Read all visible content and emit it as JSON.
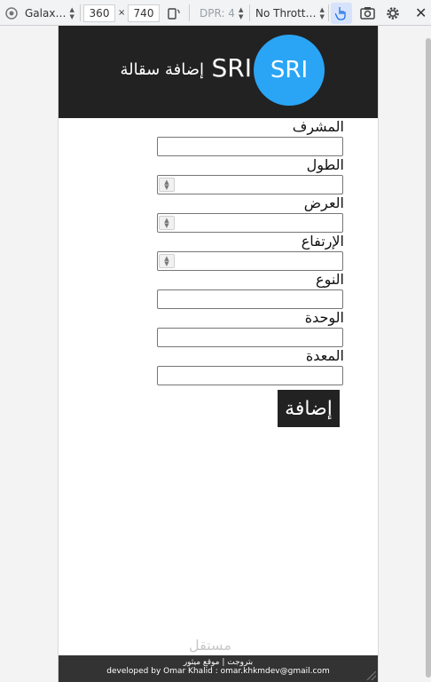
{
  "devtools": {
    "device": "Galax…",
    "width": "360",
    "times": "×",
    "height": "740",
    "dpr": "DPR: 4",
    "throttle": "No Thrott…",
    "close_glyph": "✕"
  },
  "header": {
    "logo_text": "SRI",
    "brand": "SRI",
    "subtitle": "إضافة سقالة",
    "background": "#222222",
    "logo_color": "#2aa5f5"
  },
  "form": {
    "fields": [
      {
        "label": "المشرف",
        "type": "text",
        "value": ""
      },
      {
        "label": "الطول",
        "type": "number",
        "value": ""
      },
      {
        "label": "العرض",
        "type": "number",
        "value": ""
      },
      {
        "label": "الإرتفاع",
        "type": "number",
        "value": ""
      },
      {
        "label": "النوع",
        "type": "text",
        "value": ""
      },
      {
        "label": "الوحدة",
        "type": "text",
        "value": ""
      },
      {
        "label": "المعدة",
        "type": "text",
        "value": ""
      }
    ],
    "submit_label": "إضافة"
  },
  "footer": {
    "line1": "بتروجت | موقع ميثور",
    "line2": "developed by Omar Khalid : omar.khkmdev@gmail.com"
  },
  "watermark": "مستقل"
}
